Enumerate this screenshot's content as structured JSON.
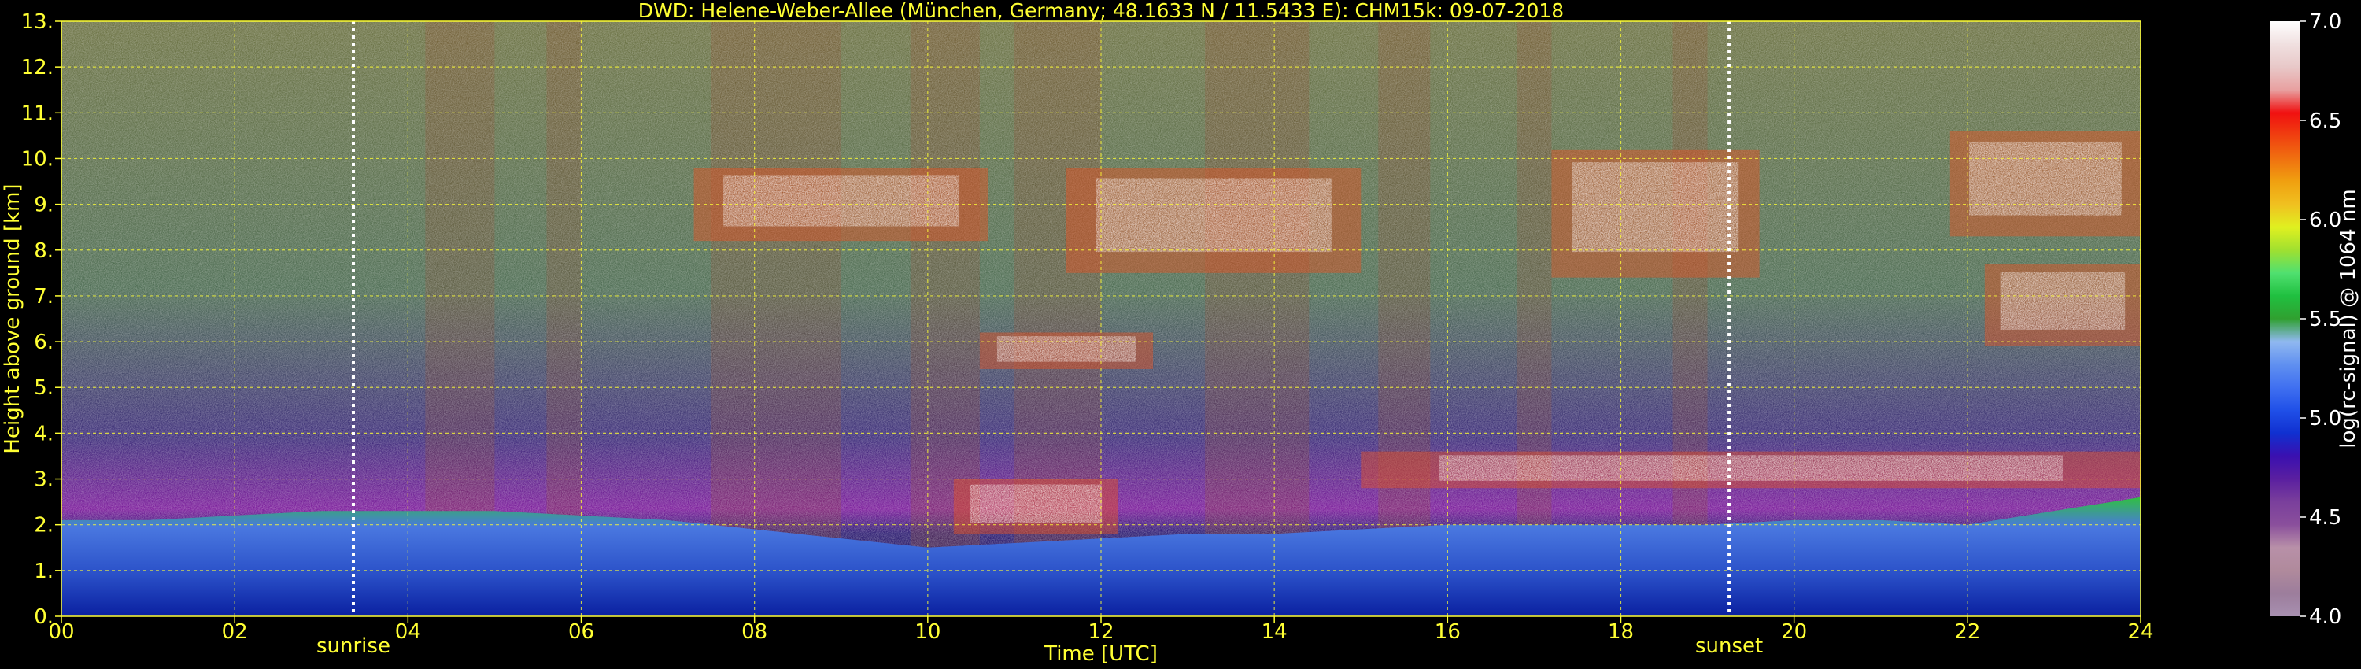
{
  "chart_data": {
    "type": "heatmap",
    "title": "DWD: Helene-Weber-Allee (München, Germany; 48.1633 N / 11.5433 E):    CHM15k: 09-07-2018",
    "xlabel": "Time [UTC]",
    "ylabel": "Height above ground [km]",
    "xlim": [
      0,
      24
    ],
    "ylim": [
      0,
      13
    ],
    "x_ticks": [
      "00",
      "02",
      "04",
      "06",
      "08",
      "10",
      "12",
      "14",
      "16",
      "18",
      "20",
      "22",
      "24"
    ],
    "y_ticks": [
      "0.",
      "1.",
      "2.",
      "3.",
      "4.",
      "5.",
      "6.",
      "7.",
      "8.",
      "9.",
      "10.",
      "11.",
      "12.",
      "13."
    ],
    "grid": true,
    "annotations": [
      {
        "label": "sunrise",
        "x": 3.37
      },
      {
        "label": "sunset",
        "x": 19.25
      }
    ],
    "colorbar": {
      "label": "log(rc-signal) @ 1064 nm",
      "range": [
        4.0,
        7.0
      ],
      "ticks": [
        "4.0",
        "4.5",
        "5.0",
        "5.5",
        "6.0",
        "6.5",
        "7.0"
      ],
      "colors": [
        "#a890b0",
        "#9c7d9c",
        "#b08a9c",
        "#b890a8",
        "#8a4f9c",
        "#7a3f9c",
        "#5a1fa0",
        "#3a10b0",
        "#1030d0",
        "#2050e8",
        "#4070f0",
        "#6090f0",
        "#90b8f0",
        "#30a030",
        "#20c040",
        "#50e070",
        "#a0e030",
        "#e0f020",
        "#f0c020",
        "#f0a010",
        "#f07010",
        "#f04010",
        "#f01010",
        "#e8a0a0",
        "#e8c8c8",
        "#f0e0e0",
        "#ffffff"
      ]
    },
    "boundary_layer_top_km": {
      "x": [
        0,
        1,
        2,
        3,
        4,
        5,
        6,
        7,
        8,
        9,
        10,
        11,
        12,
        13,
        14,
        15,
        16,
        17,
        18,
        19,
        20,
        21,
        22,
        23,
        24
      ],
      "y": [
        2.1,
        2.1,
        2.2,
        2.3,
        2.3,
        2.3,
        2.2,
        2.1,
        1.9,
        1.7,
        1.5,
        1.6,
        1.7,
        1.8,
        1.8,
        1.9,
        2.0,
        2.0,
        2.0,
        2.0,
        2.1,
        2.1,
        2.0,
        2.3,
        2.6
      ]
    },
    "cloud_layers": [
      {
        "x_start": 7.3,
        "x_end": 10.7,
        "y_bottom": 8.2,
        "y_top": 9.8
      },
      {
        "x_start": 11.6,
        "x_end": 15.0,
        "y_bottom": 7.5,
        "y_top": 9.8
      },
      {
        "x_start": 10.6,
        "x_end": 12.6,
        "y_bottom": 5.4,
        "y_top": 6.2
      },
      {
        "x_start": 17.2,
        "x_end": 19.6,
        "y_bottom": 7.4,
        "y_top": 10.2
      },
      {
        "x_start": 21.8,
        "x_end": 24.0,
        "y_bottom": 8.3,
        "y_top": 10.6
      },
      {
        "x_start": 22.2,
        "x_end": 24.0,
        "y_bottom": 5.9,
        "y_top": 7.7
      },
      {
        "x_start": 10.3,
        "x_end": 12.2,
        "y_bottom": 1.8,
        "y_top": 3.0
      },
      {
        "x_start": 15.0,
        "x_end": 24.0,
        "y_bottom": 2.8,
        "y_top": 3.6
      }
    ]
  }
}
